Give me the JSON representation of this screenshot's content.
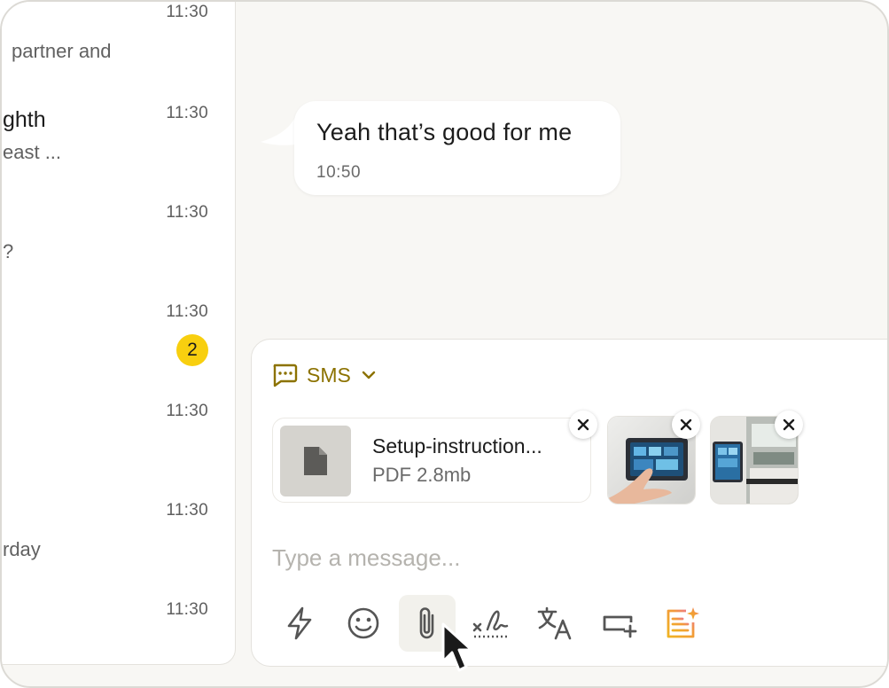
{
  "conversations": [
    {
      "time": "11:30",
      "name": "",
      "preview": "partner and"
    },
    {
      "time": "11:30",
      "name": "ghth",
      "preview": "east ..."
    },
    {
      "time": "11:30",
      "name": "",
      "preview": "?"
    },
    {
      "time": "11:30",
      "name": "",
      "preview": "",
      "badge": "2"
    },
    {
      "time": "11:30",
      "name": "",
      "preview": ""
    },
    {
      "time": "11:30",
      "name": "",
      "preview": "rday"
    },
    {
      "time": "11:30",
      "name": "",
      "preview": ""
    }
  ],
  "message": {
    "text": "Yeah that’s good for me",
    "time": "10:50"
  },
  "composer": {
    "channel_label": "SMS",
    "channel_icon": "message-square-icon",
    "attachments": {
      "file": {
        "name": "Setup-instruction...",
        "meta": "PDF 2.8mb",
        "icon": "document-icon"
      },
      "images": [
        "smart-panel-photo",
        "kitchen-panel-photo"
      ]
    },
    "placeholder": "Type a message...",
    "tools": [
      "lightning-icon",
      "emoji-icon",
      "paperclip-icon",
      "signature-icon",
      "translate-icon",
      "add-field-icon",
      "ai-sparkle-icon"
    ]
  },
  "colors": {
    "accent": "#8c7200",
    "badge": "#f8cf0f",
    "ai": "#f0b323"
  }
}
